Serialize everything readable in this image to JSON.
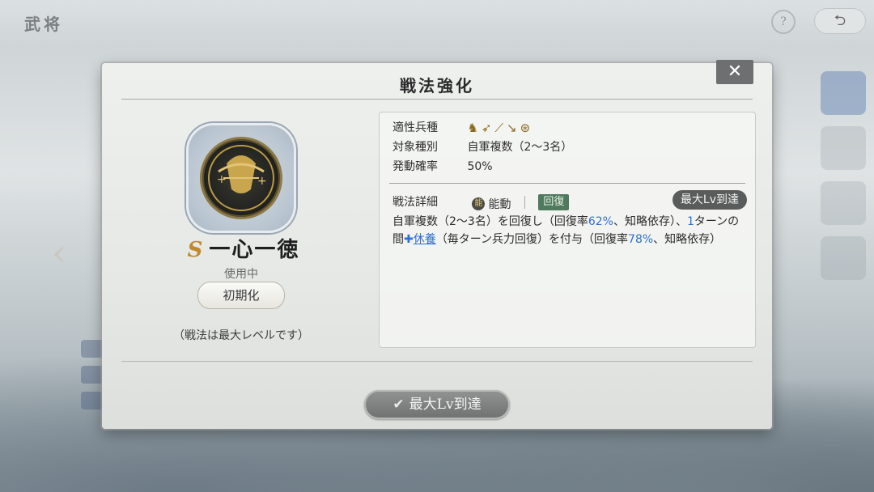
{
  "background": {
    "title": "武将",
    "help_label": "?",
    "back_label": "⮌"
  },
  "modal": {
    "title": "戦法強化",
    "close_label": "✕"
  },
  "skill": {
    "rank": "S",
    "name": "一心一徳",
    "status": "使用中",
    "reset_label": "初期化",
    "max_note": "（戦法は最大レベルです）"
  },
  "info": {
    "troop_label": "適性兵種",
    "troop_icons": [
      "cavalry-icon",
      "bow-icon",
      "gun-icon",
      "spear-icon",
      "shield-icon"
    ],
    "target_label": "対象種別",
    "target_value": "自軍複数（2〜3名）",
    "rate_label": "発動確率",
    "rate_value": "50%",
    "detail_label": "戦法詳細",
    "type_ring": "能",
    "type_label": "能動",
    "heal_tag": "回復",
    "max_tag": "最大Lv到達",
    "desc": {
      "part1": "自軍複数（2〜3名）を回復し（回復率",
      "heal_rate": "62%",
      "part2": "、知略依存）、",
      "turns": "1",
      "part3": "ターンの間",
      "buff_icon": "✚",
      "buff_name": "休養",
      "part4": "（毎ターン兵力回復）を付与（回復率",
      "regen_rate": "78%",
      "part5": "、知略依存）"
    }
  },
  "footer": {
    "max_button_label": "最大Lv到達",
    "check": "✔"
  },
  "colors": {
    "accent_blue": "#2f6fd1",
    "heal_green": "#4f7a5e",
    "rank_gold": "#c08a2a"
  }
}
